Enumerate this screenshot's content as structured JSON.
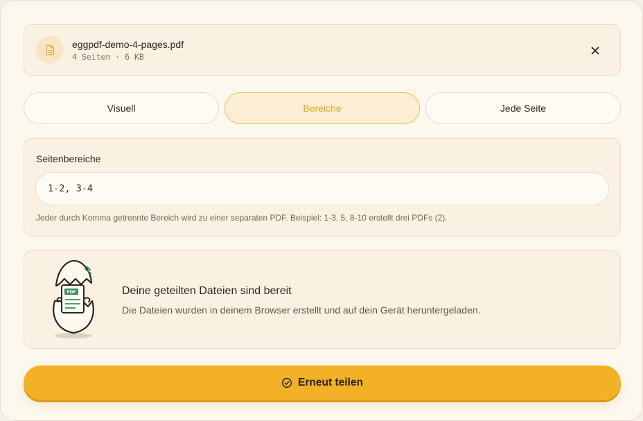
{
  "file": {
    "icon": "file-text-icon",
    "name": "eggpdf-demo-4-pages.pdf",
    "meta": "4 Seiten · 6 KB"
  },
  "tabs": [
    {
      "label": "Visuell",
      "active": false
    },
    {
      "label": "Bereiche",
      "active": true
    },
    {
      "label": "Jede Seite",
      "active": false
    }
  ],
  "ranges": {
    "label": "Seitenbereiche",
    "value": "1-2, 3-4",
    "hint": "Jeder durch Komma getrennte Bereich wird zu einer separaten PDF. Beispiel: 1-3, 5, 8-10 erstellt drei PDFs (2)."
  },
  "result": {
    "illustration": "hatched-egg-with-pdf",
    "badge": "PDF",
    "title": "Deine geteilten Dateien sind bereit",
    "description": "Die Dateien wurden in deinem Browser erstellt und auf dein Gerät heruntergeladen."
  },
  "action": {
    "icon": "check-circle-icon",
    "label": "Erneut teilen"
  },
  "colors": {
    "accent": "#f2b126",
    "accent_text": "#e6a51c",
    "panel": "#fbf1e3",
    "background": "#fdf8ee"
  }
}
